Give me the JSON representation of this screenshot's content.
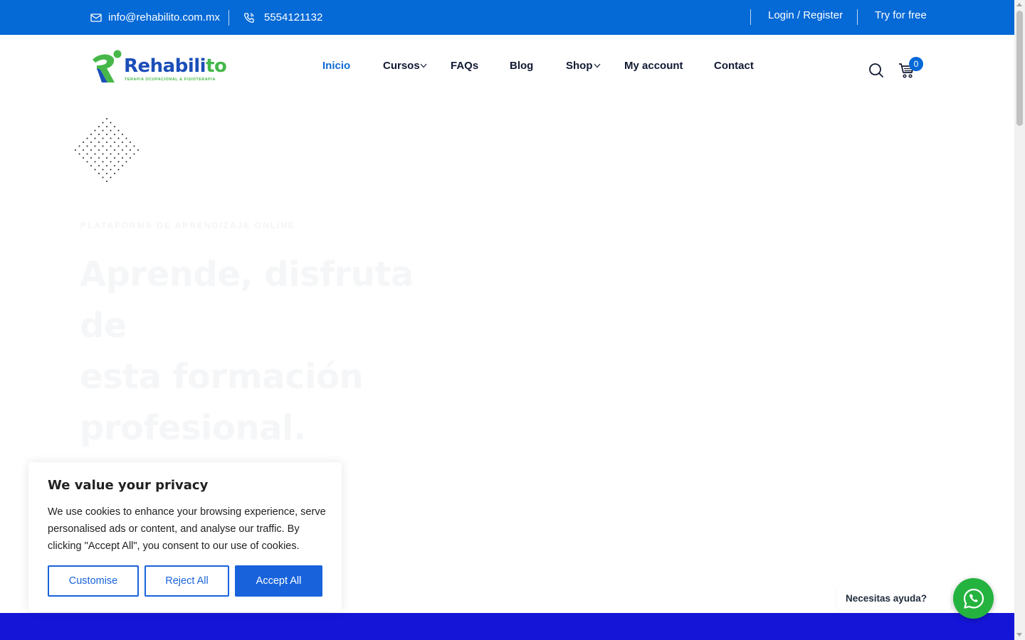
{
  "topbar": {
    "email": "info@rehabilito.com.mx",
    "phone": "5554121132",
    "login_label": "Login / Register",
    "try_label": "Try for free"
  },
  "logo": {
    "name_main": "Rehabili",
    "name_accent": "to",
    "tagline": "TERAPIA OCUPACIONAL & FISIOTERAPIA"
  },
  "nav": {
    "items": [
      {
        "label": "Inicio",
        "active": true
      },
      {
        "label": "Cursos",
        "has_dropdown": true
      },
      {
        "label": "FAQs"
      },
      {
        "label": "Blog"
      },
      {
        "label": "Shop",
        "has_dropdown": true
      },
      {
        "label": "My account"
      },
      {
        "label": "Contact"
      }
    ],
    "cart_count": "0"
  },
  "hero": {
    "kicker": "PLATAFORMA DE APRENDIZAJE ONLINE",
    "title_line1": "Aprende, disfruta de",
    "title_line2": "esta formación",
    "title_line3": "profesional."
  },
  "cookie": {
    "title": "We value your privacy",
    "text": "We use cookies to enhance your browsing experience, serve personalised ads or content, and analyse our traffic. By clicking \"Accept All\", you consent to our use of cookies.",
    "customise_label": "Customise",
    "reject_label": "Reject All",
    "accept_label": "Accept All"
  },
  "whatsapp": {
    "label": "Necesitas ayuda?"
  },
  "colors": {
    "brand_blue": "#0569d6",
    "brand_green": "#46b84a",
    "cookie_accent": "#1863dc",
    "whatsapp_green": "#25b33f",
    "bottom_band": "#1515d8"
  }
}
